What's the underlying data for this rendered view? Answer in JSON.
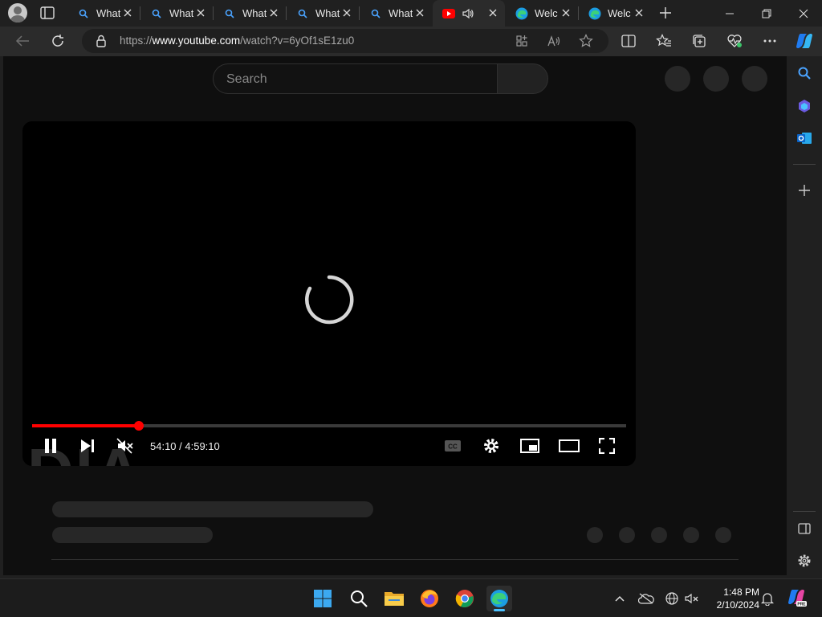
{
  "tabs": [
    {
      "title": "What",
      "icon": "search-icon"
    },
    {
      "title": "What",
      "icon": "search-icon"
    },
    {
      "title": "What",
      "icon": "search-icon"
    },
    {
      "title": "What",
      "icon": "search-icon"
    },
    {
      "title": "What",
      "icon": "search-icon"
    },
    {
      "title": "",
      "icon": "youtube-icon",
      "audio": "speaker-icon",
      "active": true
    },
    {
      "title": "Welc",
      "icon": "edge-icon"
    },
    {
      "title": "Welc",
      "icon": "edge-icon"
    }
  ],
  "address_bar": {
    "scheme": "https://",
    "host": "www.youtube.com",
    "path": "/watch?v=6yOf1sE1zu0"
  },
  "youtube": {
    "search_placeholder": "Search",
    "watermark": "DIA"
  },
  "player": {
    "current_time": "54:10",
    "duration": "4:59:10",
    "time_display": "54:10 / 4:59:10",
    "progress_fraction": 0.18,
    "muted": true,
    "playing": true
  },
  "taskbar": {
    "time": "1:48 PM",
    "date": "2/10/2024",
    "apps": [
      "windows-start-icon",
      "search-icon",
      "file-explorer-icon",
      "firefox-icon",
      "chrome-icon",
      "edge-icon"
    ]
  },
  "colors": {
    "youtube_red": "#ff0000",
    "edge_accent": "#4cc2ff",
    "page_bg": "#0f0f0f"
  }
}
